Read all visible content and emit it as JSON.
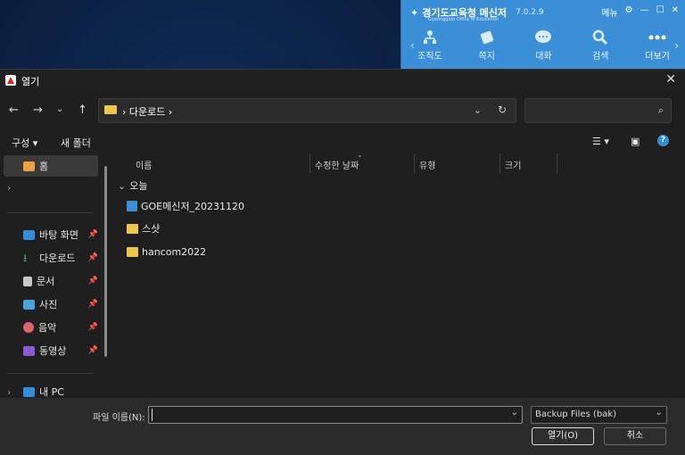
{
  "messenger": {
    "title": "경기도교육청 메신저",
    "version": "7.0.2.9",
    "subtitle": "Gyeonggido Office of Education",
    "menu_label": "메뉴",
    "nav": [
      "조직도",
      "쪽지",
      "대화",
      "검색",
      "더보기"
    ]
  },
  "dialog": {
    "title": "열기",
    "path": [
      "다운로드"
    ],
    "search_placeholder": "",
    "toolbar": {
      "organize": "구성",
      "new_folder": "새 폴더"
    },
    "sidebar": {
      "home": "홈",
      "quick": [
        {
          "label": "바탕 화면",
          "icon": "desktop-icon",
          "color": "#2f8fd8"
        },
        {
          "label": "다운로드",
          "icon": "download-icon",
          "color": "#3bb36a"
        },
        {
          "label": "문서",
          "icon": "document-icon",
          "color": "#c8c8c8"
        },
        {
          "label": "사진",
          "icon": "picture-icon",
          "color": "#4aa3df"
        },
        {
          "label": "음악",
          "icon": "music-icon",
          "color": "#e0626a"
        },
        {
          "label": "동영상",
          "icon": "video-icon",
          "color": "#8b5bd6"
        }
      ],
      "this_pc": "내 PC"
    },
    "columns": [
      "이름",
      "수정한 날짜",
      "유형",
      "크기"
    ],
    "group": "오늘",
    "files": [
      {
        "name": "GOE메신저_20231120",
        "icon": "app-file-icon",
        "color": "#3a8fd6"
      },
      {
        "name": "스샷",
        "icon": "folder-icon",
        "color": "#f0c64a"
      },
      {
        "name": "hancom2022",
        "icon": "folder-icon",
        "color": "#f0c64a"
      }
    ],
    "filename_label": "파일 이름(N):",
    "filename_value": "",
    "filetype": "Backup Files (bak)",
    "open_button": "열기(O)",
    "cancel_button": "취소"
  }
}
